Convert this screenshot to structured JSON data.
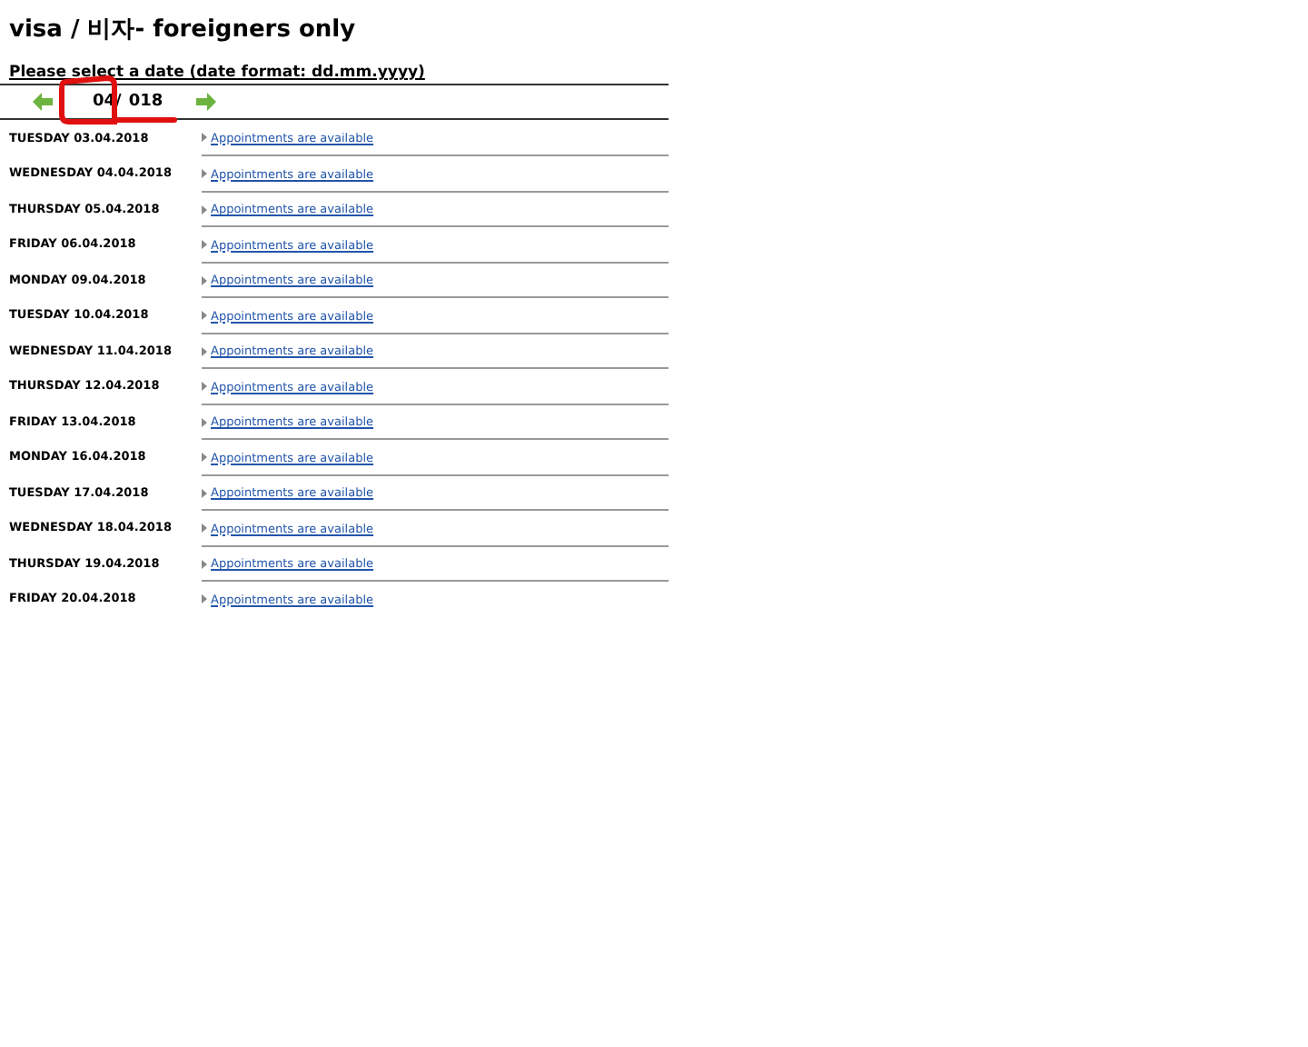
{
  "title": "visa / 비자- foreigners only",
  "subtitle": "Please select a date (date format: dd.mm.yyyy)",
  "month_nav": {
    "month_text": "04/",
    "year_text": "018"
  },
  "days": [
    {
      "date": "TUESDAY 03.04.2018",
      "link": "Appointments are available"
    },
    {
      "date": "WEDNESDAY 04.04.2018",
      "link": "Appointments are available"
    },
    {
      "date": "THURSDAY 05.04.2018",
      "link": "Appointments are available"
    },
    {
      "date": "FRIDAY 06.04.2018",
      "link": "Appointments are available"
    },
    {
      "date": "MONDAY 09.04.2018",
      "link": "Appointments are available"
    },
    {
      "date": "TUESDAY 10.04.2018",
      "link": "Appointments are available"
    },
    {
      "date": "WEDNESDAY 11.04.2018",
      "link": "Appointments are available"
    },
    {
      "date": "THURSDAY 12.04.2018",
      "link": "Appointments are available"
    },
    {
      "date": "FRIDAY 13.04.2018",
      "link": "Appointments are available"
    },
    {
      "date": "MONDAY 16.04.2018",
      "link": "Appointments are available"
    },
    {
      "date": "TUESDAY 17.04.2018",
      "link": "Appointments are available"
    },
    {
      "date": "WEDNESDAY 18.04.2018",
      "link": "Appointments are available"
    },
    {
      "date": "THURSDAY 19.04.2018",
      "link": "Appointments are available"
    },
    {
      "date": "FRIDAY 20.04.2018",
      "link": "Appointments are available"
    }
  ]
}
